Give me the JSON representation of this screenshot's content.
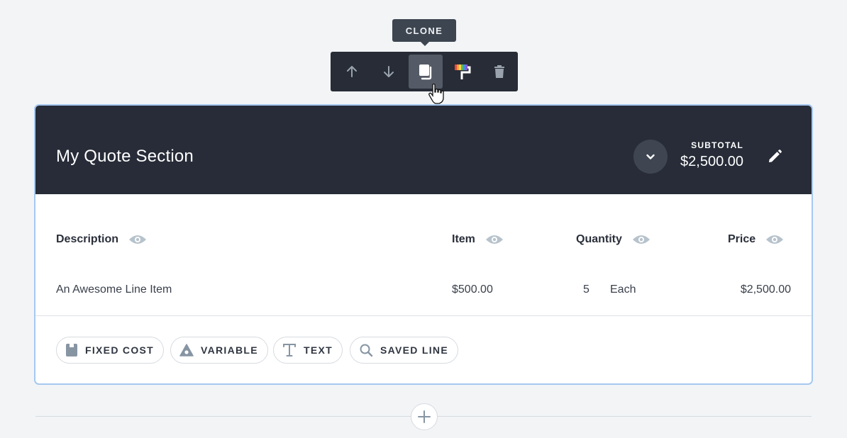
{
  "tooltip": {
    "text": "CLONE"
  },
  "toolbar": {
    "buttons": [
      {
        "name": "move-up-icon"
      },
      {
        "name": "move-down-icon"
      },
      {
        "name": "clone-icon",
        "active": true
      },
      {
        "name": "paint-roller-icon"
      },
      {
        "name": "trash-icon"
      }
    ]
  },
  "section": {
    "title": "My Quote Section",
    "subtotal_label": "SUBTOTAL",
    "subtotal_value": "$2,500.00",
    "columns": {
      "description": "Description",
      "item": "Item",
      "quantity": "Quantity",
      "price": "Price"
    },
    "rows": [
      {
        "description": "An Awesome Line Item",
        "item": "$500.00",
        "quantity": "5",
        "unit": "Each",
        "price": "$2,500.00"
      }
    ],
    "add_buttons": {
      "fixed_cost": "FIXED COST",
      "variable": "VARIABLE",
      "text": "TEXT",
      "saved_line": "SAVED LINE"
    }
  },
  "colors": {
    "header_bg": "#272c38",
    "toolbar_bg": "#272c36",
    "accent_border": "#a6c8f0",
    "icon_gray": "#8795a3"
  }
}
